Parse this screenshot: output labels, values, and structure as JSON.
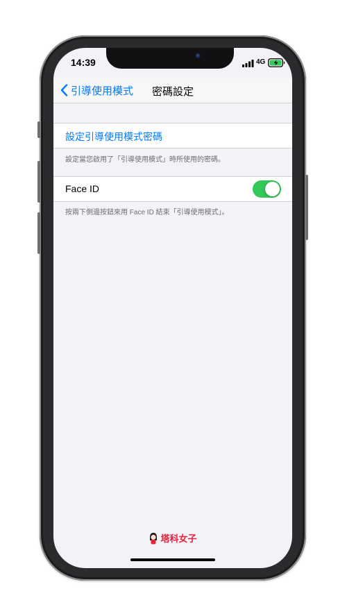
{
  "status_bar": {
    "time": "14:39",
    "network": "4G",
    "icons": [
      "signal-bars-icon",
      "battery-charging-icon"
    ]
  },
  "nav": {
    "back_label": "引導使用模式",
    "title": "密碼設定",
    "back_icon": "chevron-left-icon"
  },
  "settings": {
    "passcode_label": "設定引導使用模式密碼",
    "passcode_footer": "設定當您啟用了「引導使用模式」時所使用的密碼。",
    "faceid_label": "Face ID",
    "faceid_enabled": true,
    "faceid_footer": "按兩下側邊按鈕來用 Face ID 結束「引導使用模式」。"
  },
  "watermark": {
    "text": "塔科女子",
    "icon": "girl-avatar-icon"
  },
  "colors": {
    "accent": "#007aff",
    "toggle_on": "#34c759",
    "background": "#f2f2f7",
    "watermark": "#e8223b"
  }
}
